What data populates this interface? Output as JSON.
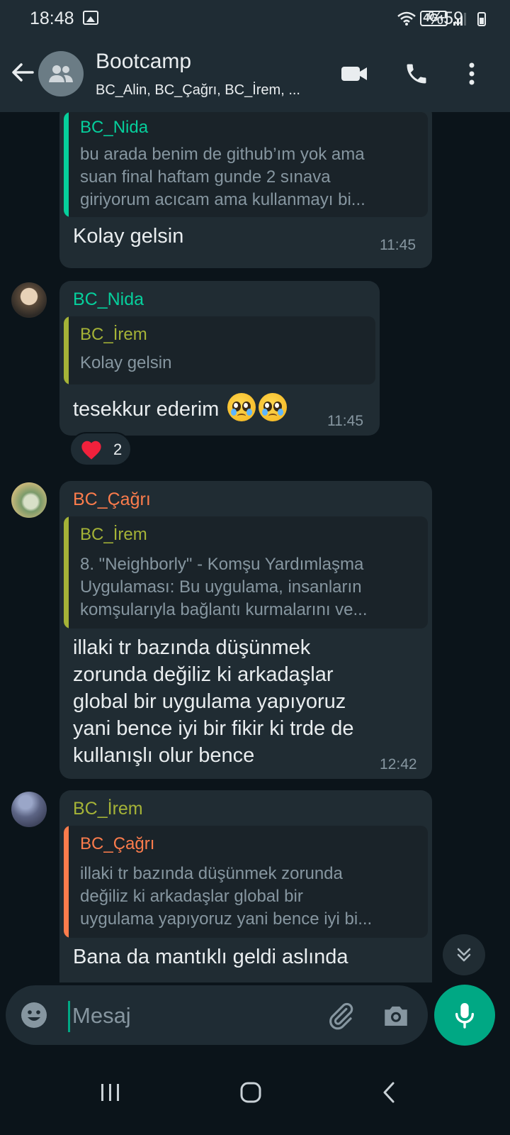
{
  "status_bar": {
    "time": "18:48",
    "battery": "%59",
    "network": "4G+"
  },
  "header": {
    "title": "Bootcamp",
    "subtitle": "BC_Alin, BC_Çağrı, BC_İrem, ...",
    "icons": [
      "back-arrow-icon",
      "group-icon",
      "video-call-icon",
      "voice-call-icon",
      "more-options-icon"
    ]
  },
  "colors": {
    "nida": "#06cf9c",
    "irem": "#a5b337",
    "cagri": "#fc7c4c",
    "accent": "#00a884",
    "bubble": "#202c33"
  },
  "messages": [
    {
      "quote": {
        "sender": "BC_Nida",
        "lines": [
          "bu arada benim de github’ım yok ama",
          "suan final haftam gunde 2 sınava",
          "giriyorum acıcam ama kullanmayı bi..."
        ]
      },
      "lines": [
        "Kolay gelsin"
      ],
      "time": "11:45"
    },
    {
      "sender": "BC_Nida",
      "quote": {
        "sender": "BC_İrem",
        "lines": [
          "Kolay gelsin"
        ]
      },
      "text": "tesekkur ederim",
      "time": "11:45",
      "reaction": {
        "emoji": "❤️",
        "count": "2"
      }
    },
    {
      "sender": "BC_Çağrı",
      "quote": {
        "sender": "BC_İrem",
        "lines": [
          "8. \"Neighborly\" - Komşu Yardımlaşma",
          "Uygulaması: Bu uygulama, insanların",
          "komşularıyla bağlantı kurmalarını ve..."
        ]
      },
      "lines": [
        "illaki tr bazında düşünmek",
        "zorunda değiliz ki arkadaşlar",
        "global bir uygulama yapıyoruz",
        "yani bence iyi bir fikir ki trde de",
        "kullanışlı olur bence"
      ],
      "time": "12:42"
    },
    {
      "sender": "BC_İrem",
      "quote": {
        "sender": "BC_Çağrı",
        "lines": [
          "illaki tr bazında düşünmek zorunda",
          "değiliz ki arkadaşlar global bir",
          "uygulama yapıyoruz yani bence iyi bi..."
        ]
      },
      "lines": [
        "Bana da mantıklı geldi aslında"
      ]
    }
  ],
  "input": {
    "placeholder": "Mesaj"
  }
}
